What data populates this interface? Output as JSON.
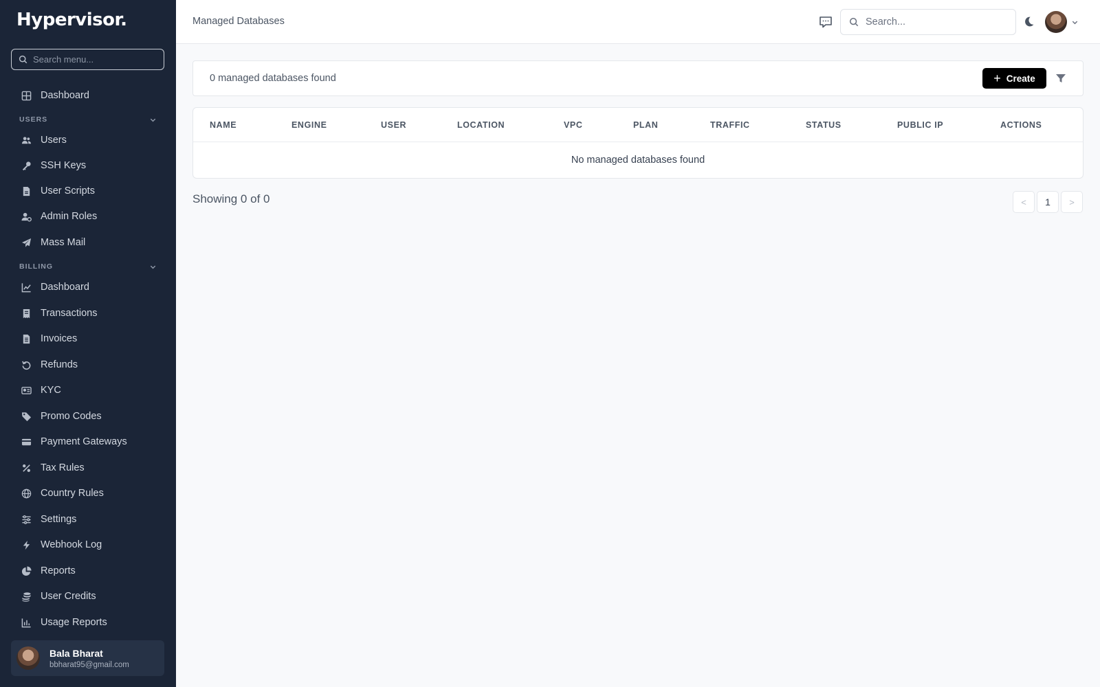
{
  "sidebar": {
    "logo": "Hypervisor.",
    "search_placeholder": "Search menu...",
    "dashboard_label": "Dashboard",
    "sections": {
      "users": {
        "label": "USERS",
        "items": [
          {
            "label": "Users",
            "icon": "users-icon"
          },
          {
            "label": "SSH Keys",
            "icon": "key-icon"
          },
          {
            "label": "User Scripts",
            "icon": "script-file-icon"
          },
          {
            "label": "Admin Roles",
            "icon": "user-cog-icon"
          },
          {
            "label": "Mass Mail",
            "icon": "paper-plane-icon"
          }
        ]
      },
      "billing": {
        "label": "BILLING",
        "items": [
          {
            "label": "Dashboard",
            "icon": "line-chart-icon"
          },
          {
            "label": "Transactions",
            "icon": "receipt-icon"
          },
          {
            "label": "Invoices",
            "icon": "invoice-file-icon"
          },
          {
            "label": "Refunds",
            "icon": "undo-icon"
          },
          {
            "label": "KYC",
            "icon": "id-card-icon"
          },
          {
            "label": "Promo Codes",
            "icon": "tag-icon"
          },
          {
            "label": "Payment Gateways",
            "icon": "credit-card-icon"
          },
          {
            "label": "Tax Rules",
            "icon": "percent-icon"
          },
          {
            "label": "Country Rules",
            "icon": "globe-icon"
          },
          {
            "label": "Settings",
            "icon": "sliders-icon"
          },
          {
            "label": "Webhook Log",
            "icon": "bolt-icon"
          },
          {
            "label": "Reports",
            "icon": "pie-chart-icon"
          },
          {
            "label": "User Credits",
            "icon": "coins-icon"
          },
          {
            "label": "Usage Reports",
            "icon": "bar-chart-icon"
          }
        ]
      }
    },
    "user": {
      "name": "Bala Bharat",
      "email": "bbharat95@gmail.com"
    }
  },
  "header": {
    "title": "Managed Databases",
    "search_placeholder": "Search..."
  },
  "main": {
    "count_text": "0 managed databases found",
    "create_label": "Create",
    "table": {
      "columns": [
        "NAME",
        "ENGINE",
        "USER",
        "LOCATION",
        "VPC",
        "PLAN",
        "TRAFFIC",
        "STATUS",
        "PUBLIC IP",
        "ACTIONS"
      ],
      "empty_text": "No managed databases found"
    },
    "pagination": {
      "showing_text": "Showing 0 of 0",
      "prev": "<",
      "current_page": "1",
      "next": ">"
    }
  },
  "colors": {
    "sidebar_bg": "#1b2537",
    "create_bg": "#000000",
    "page_bg": "#f8f9fb"
  }
}
